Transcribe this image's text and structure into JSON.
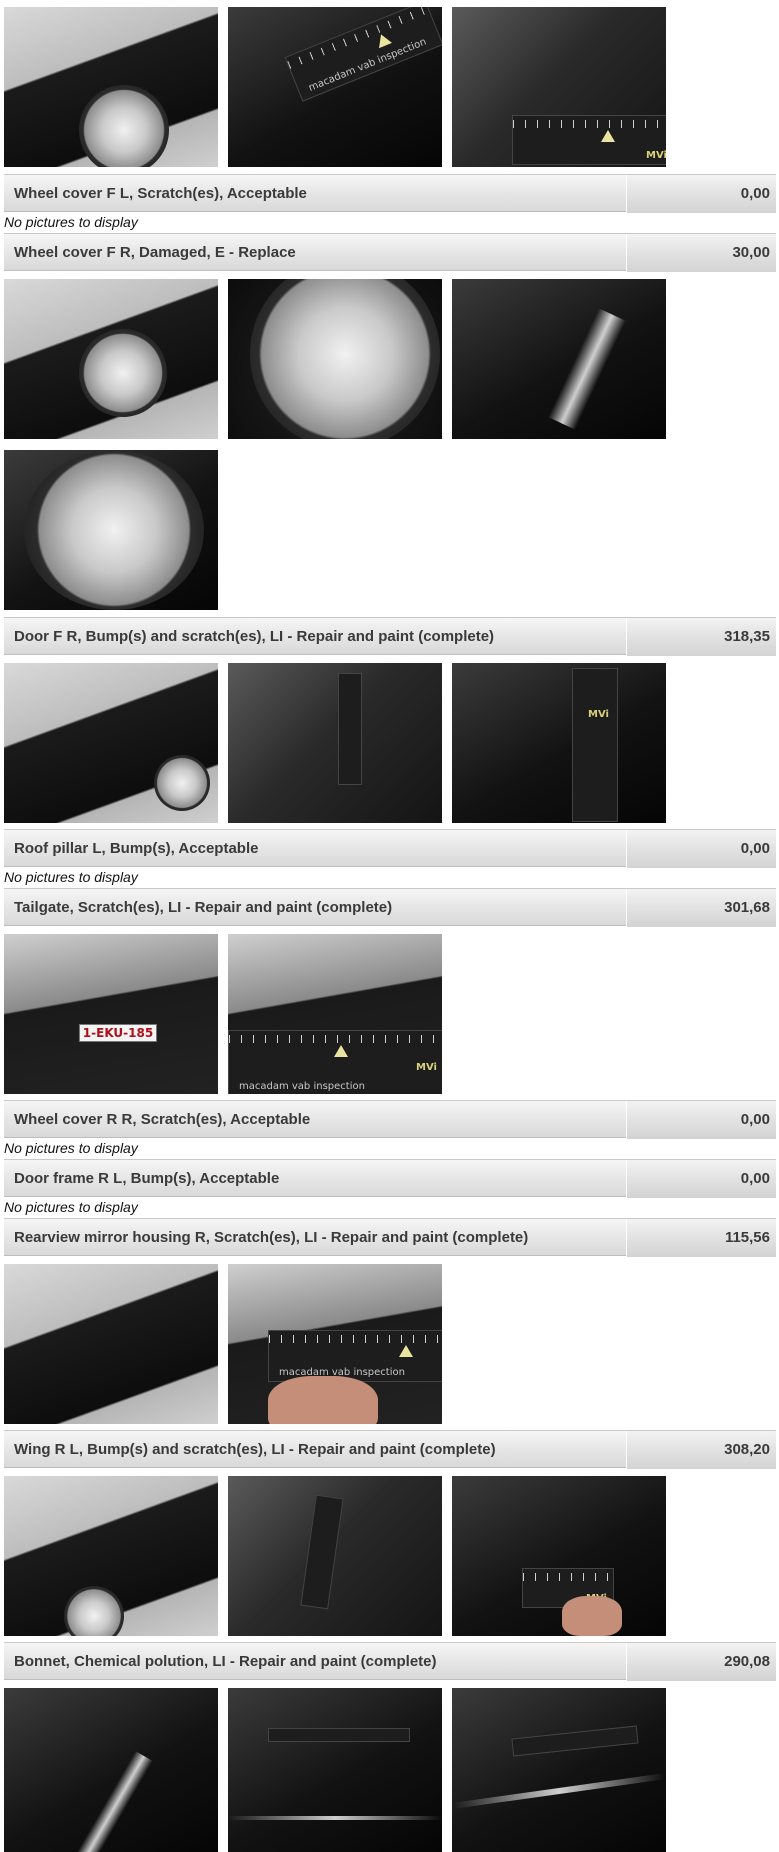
{
  "rows": [
    {
      "description": "Wheel cover F L, Scratch(es), Acceptable",
      "price": "0,00"
    },
    {
      "description": "Wheel cover F R, Damaged, E - Replace",
      "price": "30,00"
    },
    {
      "description": "Door F R, Bump(s) and scratch(es), LI - Repair and paint (complete)",
      "price": "318,35"
    },
    {
      "description": "Roof pillar L, Bump(s), Acceptable",
      "price": "0,00"
    },
    {
      "description": "Tailgate, Scratch(es), LI - Repair and paint (complete)",
      "price": "301,68"
    },
    {
      "description": "Wheel cover R R, Scratch(es), Acceptable",
      "price": "0,00"
    },
    {
      "description": "Door frame R L, Bump(s), Acceptable",
      "price": "0,00"
    },
    {
      "description": "Rearview mirror housing R, Scratch(es), LI - Repair and paint (complete)",
      "price": "115,56"
    },
    {
      "description": "Wing R L, Bump(s) and scratch(es), LI - Repair and paint (complete)",
      "price": "308,20"
    },
    {
      "description": "Bonnet, Chemical polution, LI - Repair and paint (complete)",
      "price": "290,08"
    }
  ],
  "no_pictures_text": "No pictures to display",
  "ruler_text": "macadam vab inspection",
  "ruler_logo": "MVi",
  "plate_text": "1-EKU-185",
  "colors": {
    "bar_text": "#3a3a3a",
    "plate_text": "#b0101a",
    "ruler_logo": "#d8d17a"
  }
}
